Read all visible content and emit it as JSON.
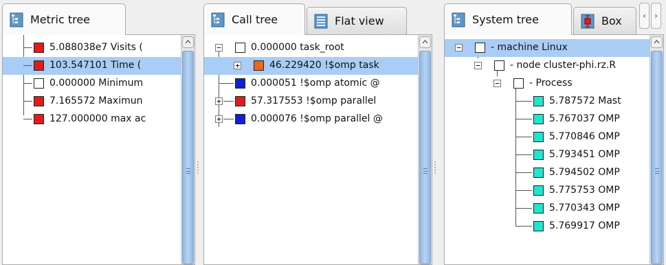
{
  "metric_pane": {
    "tab_label": "Metric tree",
    "rows": [
      {
        "text": "5.088038e7 Visits (",
        "color": "#e31b1b"
      },
      {
        "text": "103.547101 Time (",
        "color": "#e31b1b"
      },
      {
        "text": "0.000000 Minimum",
        "color": "#ffffff"
      },
      {
        "text": "7.165572 Maximun",
        "color": "#e31b1b"
      },
      {
        "text": "127.000000 max ac",
        "color": "#e31b1b"
      }
    ]
  },
  "call_pane": {
    "tabs": [
      "Call tree",
      "Flat view"
    ],
    "rows": [
      {
        "text": "0.000000 task_root",
        "color": "#ffffff"
      },
      {
        "text": "46.229420 !$omp task",
        "color": "#f06818"
      },
      {
        "text": "0.000051 !$omp atomic @",
        "color": "#1020d8"
      },
      {
        "text": "57.317553 !$omp parallel",
        "color": "#e31b1b"
      },
      {
        "text": "0.000076 !$omp parallel @",
        "color": "#1020d8"
      }
    ]
  },
  "system_pane": {
    "tabs": [
      "System tree",
      "Box"
    ],
    "nav": {
      "left": "‹",
      "right": "›"
    },
    "rows": [
      {
        "text": "- machine Linux",
        "color": "#ffffff"
      },
      {
        "text": "- node cluster-phi.rz.R",
        "color": "#ffffff"
      },
      {
        "text": "- Process",
        "color": "#ffffff"
      },
      {
        "text": "5.787572 Mast",
        "color": "#1ee6d0"
      },
      {
        "text": "5.767037 OMP",
        "color": "#1ee6d0"
      },
      {
        "text": "5.770846 OMP",
        "color": "#1ee6d0"
      },
      {
        "text": "5.793451 OMP",
        "color": "#1ee6d0"
      },
      {
        "text": "5.794502 OMP",
        "color": "#1ee6d0"
      },
      {
        "text": "5.775753 OMP",
        "color": "#1ee6d0"
      },
      {
        "text": "5.770343 OMP",
        "color": "#1ee6d0"
      },
      {
        "text": "5.769917 OMP",
        "color": "#1ee6d0"
      }
    ]
  },
  "icons": {
    "tree": "tree-icon",
    "flat": "flat-view-icon",
    "box": "box-plot-icon"
  },
  "expanders": {
    "collapsed": "+",
    "expanded": "−"
  },
  "selection_color": "#a9cdf5"
}
